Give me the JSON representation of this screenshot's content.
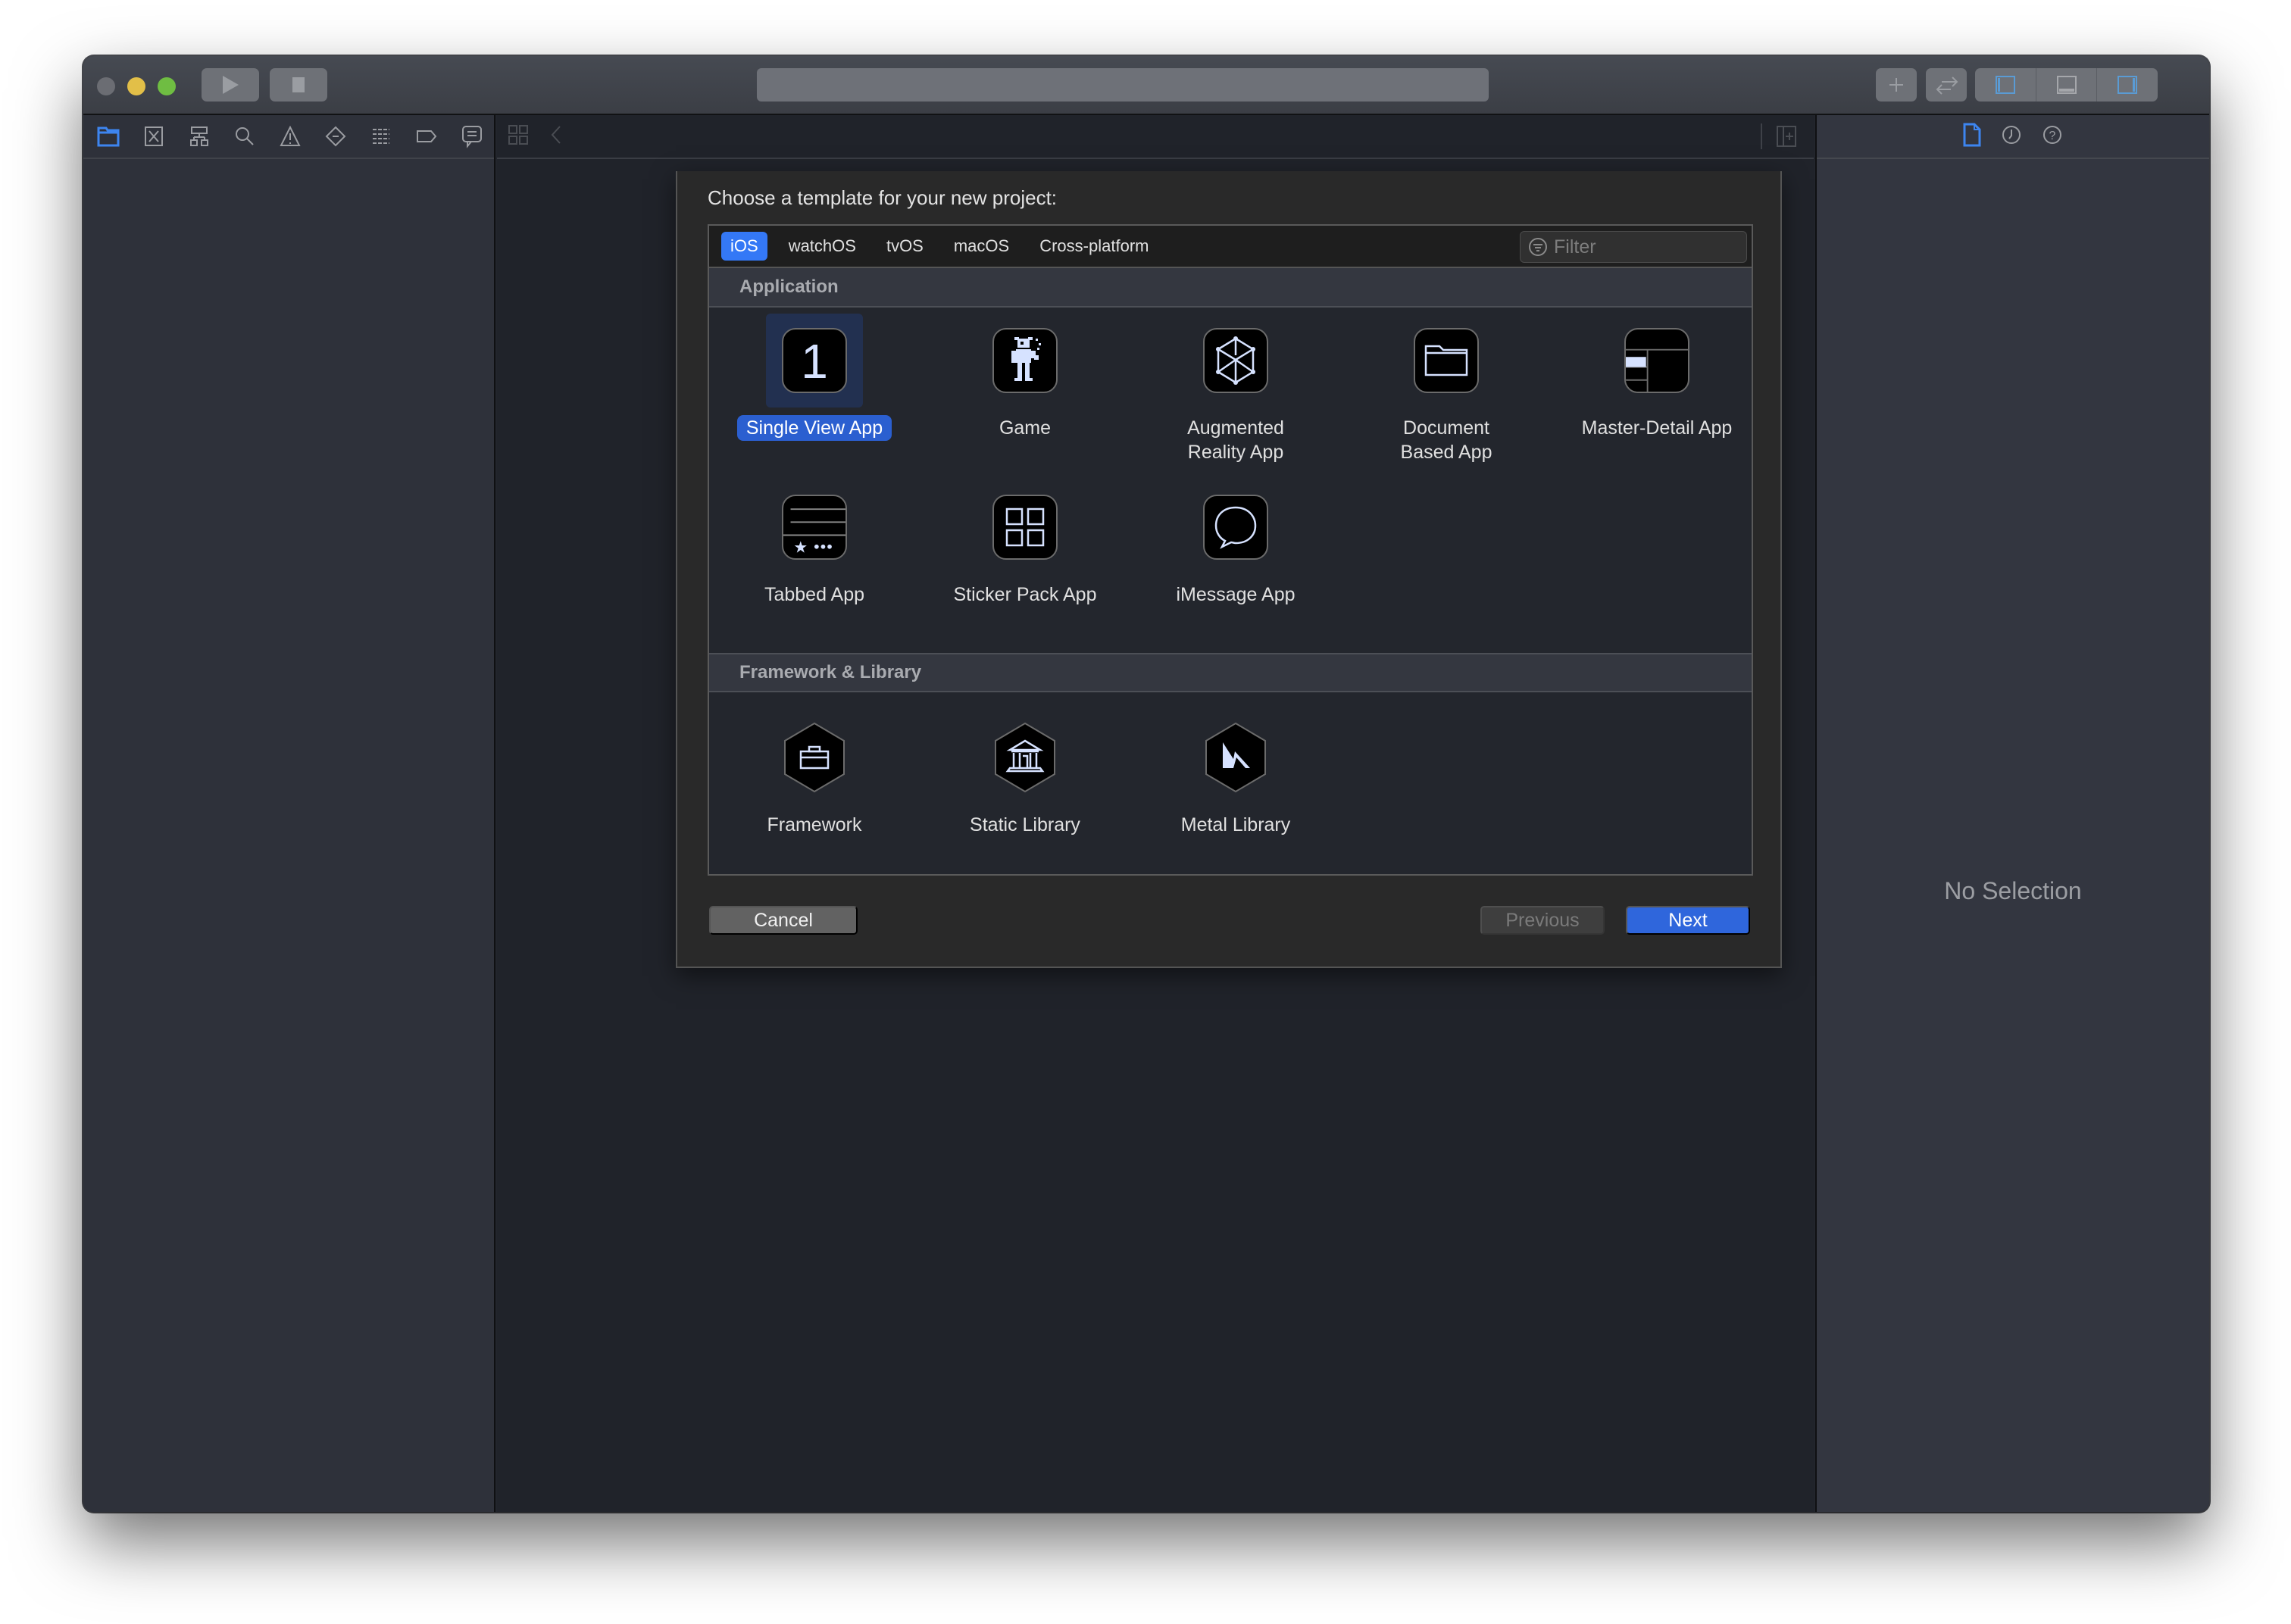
{
  "window": {
    "traffic_lights": [
      "close",
      "minimize",
      "zoom"
    ],
    "toolbar": {
      "run_icon": "play-icon",
      "stop_icon": "stop-icon",
      "activity_text": "",
      "library_icon": "plus-icon",
      "code_review_icon": "swap-arrows-icon",
      "layout_toggles": [
        "navigator-toggle",
        "debug-area-toggle",
        "inspector-toggle"
      ]
    }
  },
  "navigator": {
    "tabs": [
      {
        "name": "project-navigator",
        "icon": "folder-icon",
        "active": true
      },
      {
        "name": "source-control-navigator",
        "icon": "source-control-icon"
      },
      {
        "name": "symbol-navigator",
        "icon": "hierarchy-icon"
      },
      {
        "name": "find-navigator",
        "icon": "search-icon"
      },
      {
        "name": "issue-navigator",
        "icon": "warning-icon"
      },
      {
        "name": "test-navigator",
        "icon": "diamond-icon"
      },
      {
        "name": "debug-navigator",
        "icon": "lines-icon"
      },
      {
        "name": "breakpoint-navigator",
        "icon": "breakpoint-icon"
      },
      {
        "name": "report-navigator",
        "icon": "speech-bubble-icon"
      }
    ]
  },
  "inspector": {
    "tabs": [
      {
        "name": "file-inspector",
        "icon": "document-icon",
        "active": true
      },
      {
        "name": "history-inspector",
        "icon": "clock-icon"
      },
      {
        "name": "quick-help",
        "icon": "question-icon"
      }
    ],
    "empty_text": "No Selection"
  },
  "sheet": {
    "title": "Choose a template for your new project:",
    "platform_tabs": [
      {
        "label": "iOS",
        "active": true
      },
      {
        "label": "watchOS"
      },
      {
        "label": "tvOS"
      },
      {
        "label": "macOS"
      },
      {
        "label": "Cross-platform"
      }
    ],
    "filter": {
      "placeholder": "Filter",
      "value": ""
    },
    "sections": [
      {
        "title": "Application",
        "templates": [
          {
            "label": "Single View App",
            "icon": "single-view-icon",
            "selected": true
          },
          {
            "label": "Game",
            "icon": "game-character-icon"
          },
          {
            "label": "Augmented\nReality App",
            "icon": "ar-cube-icon"
          },
          {
            "label": "Document\nBased App",
            "icon": "folder-icon"
          },
          {
            "label": "Master-Detail App",
            "icon": "master-detail-icon"
          },
          {
            "label": "Tabbed App",
            "icon": "tab-bar-icon"
          },
          {
            "label": "Sticker Pack App",
            "icon": "sticker-grid-icon"
          },
          {
            "label": "iMessage App",
            "icon": "message-bubble-icon"
          }
        ]
      },
      {
        "title": "Framework & Library",
        "templates": [
          {
            "label": "Framework",
            "icon": "toolbox-icon"
          },
          {
            "label": "Static Library",
            "icon": "bank-building-icon"
          },
          {
            "label": "Metal Library",
            "icon": "metal-icon"
          }
        ]
      }
    ],
    "buttons": {
      "cancel": "Cancel",
      "previous": "Previous",
      "next": "Next"
    },
    "buttons_state": {
      "previous_enabled": false
    }
  },
  "colors": {
    "accent": "#3478f6",
    "selected_label": "#2b5fd0",
    "next_button": "#2f66dc",
    "icon_stroke": "#d6e2ff"
  }
}
